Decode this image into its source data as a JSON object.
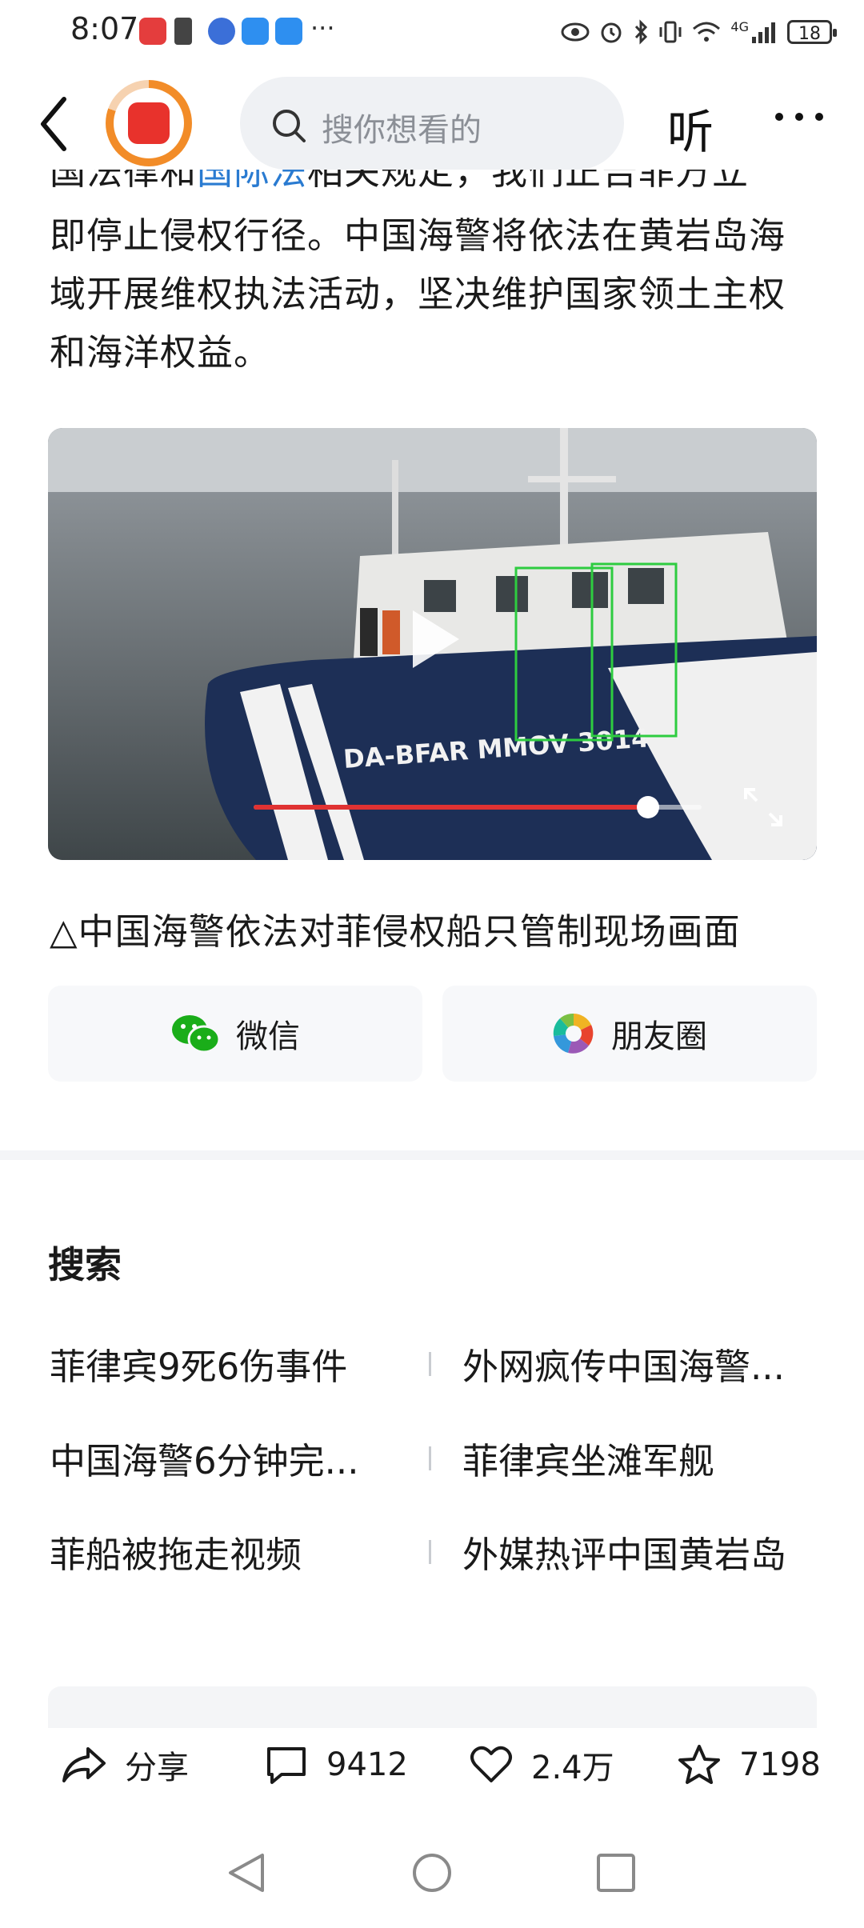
{
  "status_bar": {
    "time": "8:07",
    "more": "···",
    "network": "4G",
    "battery": "18"
  },
  "header": {
    "search_placeholder": "搜你想看的",
    "listen_label": "听"
  },
  "article": {
    "partial_line_parts": [
      "国法律和",
      "国际法",
      "相关规定，我们正告菲方立"
    ],
    "lines": [
      "即停止侵权行径。中国海警将依法在黄岩岛海",
      "域开展维权执法活动，坚决维护国家领土主权",
      "和海洋权益。"
    ]
  },
  "video": {
    "hull_text": "DA-BFAR MMOV 3014",
    "progress": 0.88,
    "caption": "△中国海警依法对菲侵权船只管制现场画面"
  },
  "share": {
    "wechat_label": "微信",
    "moments_label": "朋友圈"
  },
  "search_section": {
    "title": "搜索",
    "items": [
      "菲律宾9死6伤事件",
      "外网疯传中国海警...",
      "中国海警6分钟完...",
      "菲律宾坐滩军舰",
      "菲船被拖走视频",
      "外媒热评中国黄岩岛"
    ]
  },
  "actions": {
    "share_label": "分享",
    "comments_count": "9412",
    "likes_count": "2.4万",
    "favorites_count": "7198"
  },
  "colors": {
    "accent_orange": "#f28c28",
    "progress_red": "#e03232",
    "link_blue": "#2a7bd1",
    "wechat_green": "#1aad19"
  }
}
